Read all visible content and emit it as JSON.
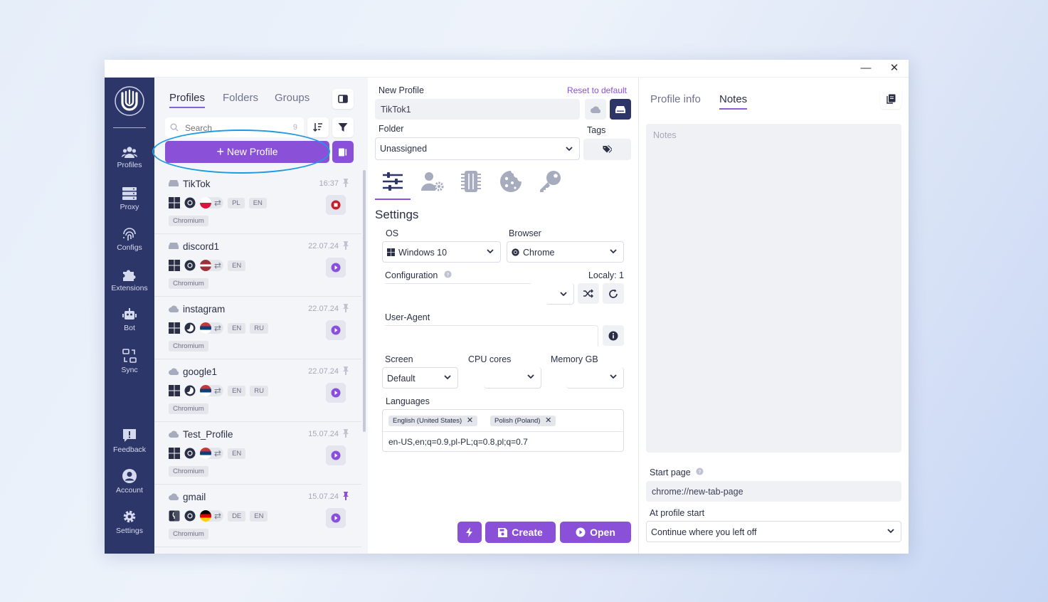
{
  "window": {
    "minimize": "—",
    "close": "✕"
  },
  "sidebar": {
    "items": [
      {
        "label": "Profiles",
        "icon": "users-icon"
      },
      {
        "label": "Proxy",
        "icon": "server-icon"
      },
      {
        "label": "Configs",
        "icon": "fingerprint-icon"
      },
      {
        "label": "Extensions",
        "icon": "puzzle-icon"
      },
      {
        "label": "Bot",
        "icon": "robot-icon"
      },
      {
        "label": "Sync",
        "icon": "sync-icon"
      },
      {
        "label": "Feedback",
        "icon": "feedback-icon"
      },
      {
        "label": "Account",
        "icon": "account-icon"
      },
      {
        "label": "Settings",
        "icon": "gear-icon"
      }
    ]
  },
  "profiles_pane": {
    "tabs": [
      "Profiles",
      "Folders",
      "Groups"
    ],
    "search_placeholder": "Search",
    "count": "9",
    "new_profile_label": "New Profile",
    "profiles": [
      {
        "name": "TikTok",
        "date": "16:37",
        "langs": [
          "PL",
          "EN"
        ],
        "browser": "Chromium",
        "running": true
      },
      {
        "name": "discord1",
        "date": "22.07.24",
        "langs": [
          "EN"
        ],
        "browser": "Chromium",
        "running": false
      },
      {
        "name": "instagram",
        "date": "22.07.24",
        "langs": [
          "EN",
          "RU"
        ],
        "browser": "Chromium",
        "running": false
      },
      {
        "name": "google1",
        "date": "22.07.24",
        "langs": [
          "EN",
          "RU"
        ],
        "browser": "Chromium",
        "running": false
      },
      {
        "name": "Test_Profile",
        "date": "15.07.24",
        "langs": [
          "EN"
        ],
        "browser": "Chromium",
        "running": false
      },
      {
        "name": "gmail",
        "date": "15.07.24",
        "langs": [
          "DE",
          "EN"
        ],
        "browser": "Chromium",
        "running": false
      }
    ]
  },
  "settings_pane": {
    "title_label": "New Profile",
    "reset_label": "Reset to default",
    "name_value": "TikTok1",
    "folder_label": "Folder",
    "folder_value": "Unassigned",
    "tags_label": "Tags",
    "section_title": "Settings",
    "os_label": "OS",
    "os_value": "Windows 10",
    "browser_label": "Browser",
    "browser_value": "Chrome",
    "configuration_label": "Configuration",
    "locally_label": "Localy: 1",
    "user_agent_label": "User-Agent",
    "screen_label": "Screen",
    "screen_value": "Default",
    "cpu_label": "CPU cores",
    "memory_label": "Memory GB",
    "languages_label": "Languages",
    "language_chips": [
      "English (United States)",
      "Polish (Poland)"
    ],
    "accept_language": "en-US,en;q=0.9,pl-PL;q=0.8,pl;q=0.7",
    "create_label": "Create",
    "open_label": "Open"
  },
  "notes_pane": {
    "tabs": [
      "Profile info",
      "Notes"
    ],
    "notes_placeholder": "Notes",
    "start_page_label": "Start page",
    "start_page_value": "chrome://new-tab-page",
    "at_start_label": "At profile start",
    "at_start_value": "Continue where you left off"
  },
  "colors": {
    "sidebar": "#2d3668",
    "accent": "#8b50d8",
    "highlight": "#1d9ae0"
  }
}
